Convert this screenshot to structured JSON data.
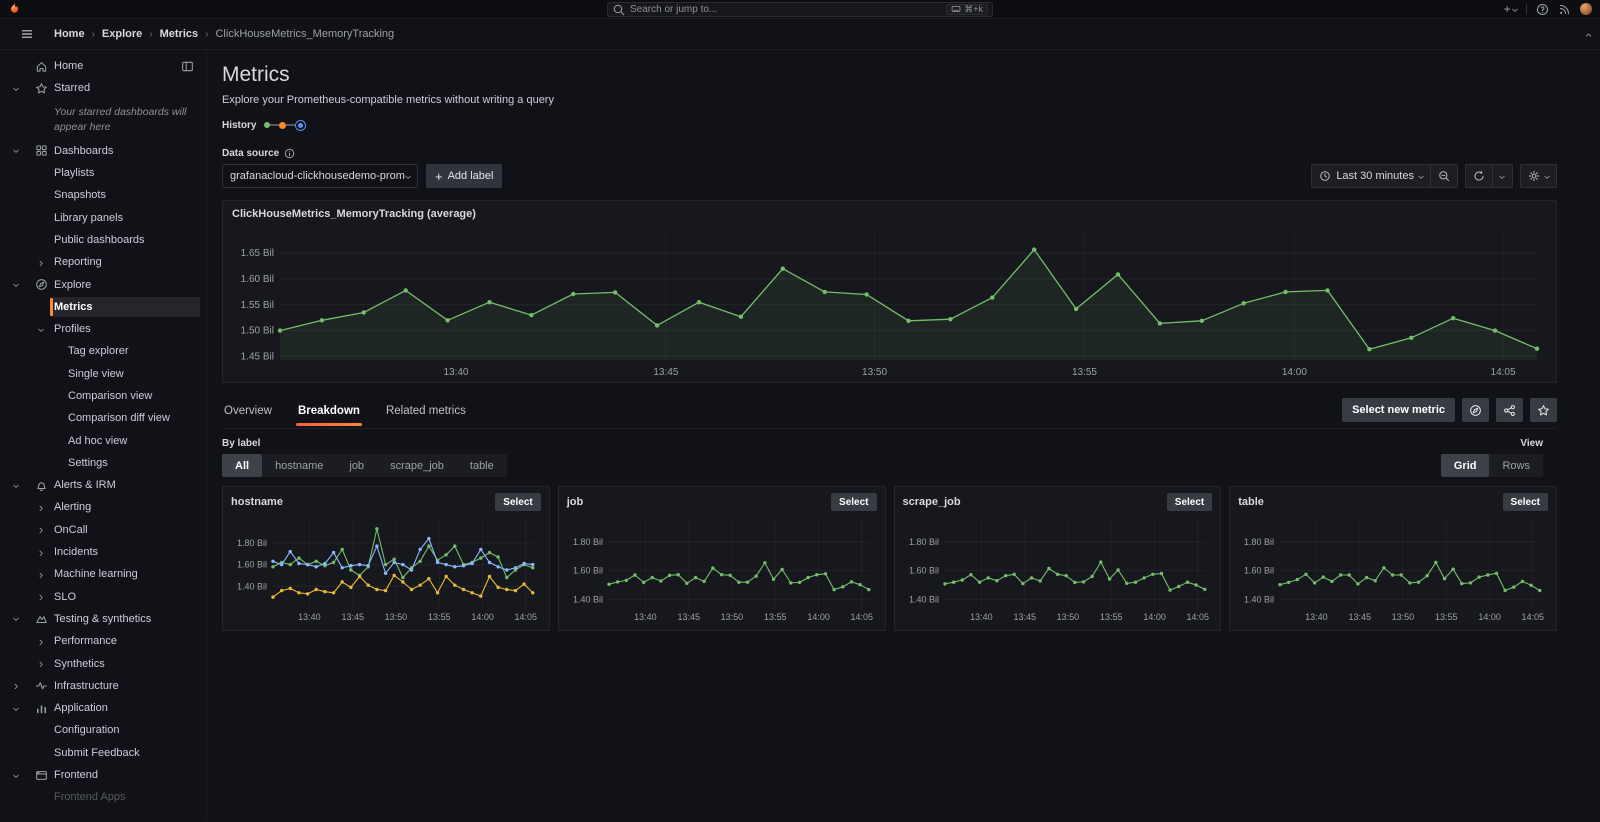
{
  "topbar": {
    "search_placeholder": "Search or jump to...",
    "shortcut": "⌘+k",
    "new_button": "+"
  },
  "breadcrumb": {
    "items": [
      "Home",
      "Explore",
      "Metrics",
      "ClickHouseMetrics_MemoryTracking"
    ]
  },
  "sidebar": {
    "items": [
      {
        "label": "Home",
        "level": 0,
        "icon": "home",
        "right_icon": "dock"
      },
      {
        "label": "Starred",
        "level": 0,
        "icon": "star",
        "chevron": "down"
      },
      {
        "label": "Your starred dashboards will appear here",
        "type": "note"
      },
      {
        "label": "Dashboards",
        "level": 0,
        "icon": "apps",
        "chevron": "down"
      },
      {
        "label": "Playlists",
        "level": 1
      },
      {
        "label": "Snapshots",
        "level": 1
      },
      {
        "label": "Library panels",
        "level": 1
      },
      {
        "label": "Public dashboards",
        "level": 1
      },
      {
        "label": "Reporting",
        "level": 1,
        "chevron": "right"
      },
      {
        "label": "Explore",
        "level": 0,
        "icon": "compass",
        "chevron": "down"
      },
      {
        "label": "Metrics",
        "level": 1,
        "selected": true
      },
      {
        "label": "Profiles",
        "level": 1,
        "chevron": "down"
      },
      {
        "label": "Tag explorer",
        "level": 2
      },
      {
        "label": "Single view",
        "level": 2
      },
      {
        "label": "Comparison view",
        "level": 2
      },
      {
        "label": "Comparison diff view",
        "level": 2
      },
      {
        "label": "Ad hoc view",
        "level": 2
      },
      {
        "label": "Settings",
        "level": 2
      },
      {
        "label": "Alerts & IRM",
        "level": 0,
        "icon": "bell",
        "chevron": "down"
      },
      {
        "label": "Alerting",
        "level": 1,
        "chevron": "right"
      },
      {
        "label": "OnCall",
        "level": 1,
        "chevron": "right"
      },
      {
        "label": "Incidents",
        "level": 1,
        "chevron": "right"
      },
      {
        "label": "Machine learning",
        "level": 1,
        "chevron": "right"
      },
      {
        "label": "SLO",
        "level": 1,
        "chevron": "right"
      },
      {
        "label": "Testing & synthetics",
        "level": 0,
        "icon": "testing",
        "chevron": "down"
      },
      {
        "label": "Performance",
        "level": 1,
        "chevron": "right"
      },
      {
        "label": "Synthetics",
        "level": 1,
        "chevron": "right"
      },
      {
        "label": "Infrastructure",
        "level": 0,
        "icon": "pulse",
        "chevron": "right"
      },
      {
        "label": "Application",
        "level": 0,
        "icon": "barchart",
        "chevron": "down"
      },
      {
        "label": "Configuration",
        "level": 1
      },
      {
        "label": "Submit Feedback",
        "level": 1
      },
      {
        "label": "Frontend",
        "level": 0,
        "icon": "frontend",
        "chevron": "down"
      },
      {
        "label": "Frontend Apps",
        "level": 1,
        "muted": true
      }
    ]
  },
  "page": {
    "title": "Metrics",
    "subtitle": "Explore your Prometheus-compatible metrics without writing a query",
    "history_label": "History",
    "datasource_label": "Data source",
    "datasource_value": "grafanacloud-clickhousedemo-prom",
    "add_label_button": "Add label"
  },
  "toolbar": {
    "time_range": "Last 30 minutes"
  },
  "tabs": {
    "items": [
      {
        "label": "Overview"
      },
      {
        "label": "Breakdown"
      },
      {
        "label": "Related metrics"
      }
    ],
    "active": "Breakdown"
  },
  "actions": {
    "select_new_metric": "Select new metric"
  },
  "by_label": {
    "label": "By label",
    "options": [
      "All",
      "hostname",
      "job",
      "scrape_job",
      "table"
    ],
    "active": "All"
  },
  "view_toggle": {
    "label": "View",
    "options": [
      "Grid",
      "Rows"
    ],
    "active": "Grid"
  },
  "panels": {
    "select_button": "Select"
  },
  "colors": {
    "accent": "#FF8833",
    "green": "#73BF69",
    "blue": "#8AB8FF",
    "yellow": "#EAB839"
  },
  "chart_data": [
    {
      "type": "line",
      "title": "ClickHouseMetrics_MemoryTracking (average)",
      "unit": "Bil",
      "ylim": [
        1.443,
        1.695
      ],
      "yticks": [
        1.45,
        1.5,
        1.55,
        1.6,
        1.65
      ],
      "ytick_labels": [
        "1.45 Bil",
        "1.50 Bil",
        "1.55 Bil",
        "1.60 Bil",
        "1.65 Bil"
      ],
      "xticks": [
        "13:40",
        "13:45",
        "13:50",
        "13:55",
        "14:00",
        "14:05"
      ],
      "xtick_fracs": [
        0.14,
        0.307,
        0.473,
        0.64,
        0.807,
        0.973
      ],
      "grid": true,
      "legend": "none",
      "series": [
        {
          "name": "average",
          "color": "#73BF69",
          "fill": true,
          "values": [
            1.5,
            1.52,
            1.535,
            1.578,
            1.52,
            1.555,
            1.53,
            1.571,
            1.574,
            1.51,
            1.555,
            1.527,
            1.62,
            1.575,
            1.57,
            1.519,
            1.522,
            1.564,
            1.657,
            1.542,
            1.609,
            1.514,
            1.519,
            1.553,
            1.575,
            1.578,
            1.464,
            1.486,
            1.524,
            1.5,
            1.465
          ]
        }
      ]
    },
    {
      "type": "line",
      "title": "hostname",
      "unit": "Bil",
      "ylim": [
        1.2,
        2.02
      ],
      "yticks": [
        1.4,
        1.6,
        1.8
      ],
      "ytick_labels": [
        "1.40 Bil",
        "1.60 Bil",
        "1.80 Bil"
      ],
      "xticks": [
        "13:40",
        "13:45",
        "13:50",
        "13:55",
        "14:00",
        "14:05"
      ],
      "xtick_fracs": [
        0.14,
        0.307,
        0.473,
        0.64,
        0.807,
        0.973
      ],
      "grid": true,
      "legend": "none",
      "series": [
        {
          "name": "series-green",
          "color": "#73BF69",
          "values": [
            1.58,
            1.62,
            1.6,
            1.66,
            1.6,
            1.63,
            1.59,
            1.62,
            1.74,
            1.55,
            1.5,
            1.58,
            1.93,
            1.6,
            1.65,
            1.48,
            1.57,
            1.63,
            1.77,
            1.64,
            1.69,
            1.77,
            1.6,
            1.62,
            1.66,
            1.71,
            1.67,
            1.48,
            1.55,
            1.6,
            1.57
          ]
        },
        {
          "name": "series-blue",
          "color": "#8AB8FF",
          "values": [
            1.63,
            1.6,
            1.72,
            1.61,
            1.6,
            1.58,
            1.61,
            1.71,
            1.57,
            1.59,
            1.6,
            1.59,
            1.77,
            1.52,
            1.62,
            1.6,
            1.55,
            1.74,
            1.84,
            1.62,
            1.6,
            1.58,
            1.59,
            1.61,
            1.74,
            1.62,
            1.58,
            1.55,
            1.57,
            1.61,
            1.6
          ]
        },
        {
          "name": "series-yellow",
          "color": "#EAB839",
          "values": [
            1.3,
            1.36,
            1.38,
            1.34,
            1.33,
            1.37,
            1.35,
            1.34,
            1.44,
            1.39,
            1.49,
            1.41,
            1.37,
            1.36,
            1.5,
            1.44,
            1.37,
            1.41,
            1.47,
            1.34,
            1.49,
            1.41,
            1.37,
            1.34,
            1.31,
            1.49,
            1.39,
            1.37,
            1.36,
            1.42,
            1.34
          ]
        }
      ]
    },
    {
      "type": "line",
      "title": "job",
      "unit": "Bil",
      "ylim": [
        1.34,
        1.96
      ],
      "yticks": [
        1.4,
        1.6,
        1.8
      ],
      "ytick_labels": [
        "1.40 Bil",
        "1.60 Bil",
        "1.80 Bil"
      ],
      "xticks": [
        "13:40",
        "13:45",
        "13:50",
        "13:55",
        "14:00",
        "14:05"
      ],
      "xtick_fracs": [
        0.14,
        0.307,
        0.473,
        0.64,
        0.807,
        0.973
      ],
      "grid": true,
      "legend": "none",
      "series": [
        {
          "name": "series-green",
          "color": "#73BF69",
          "values": [
            1.505,
            1.522,
            1.532,
            1.57,
            1.518,
            1.552,
            1.528,
            1.568,
            1.572,
            1.512,
            1.552,
            1.525,
            1.618,
            1.572,
            1.568,
            1.52,
            1.52,
            1.562,
            1.655,
            1.54,
            1.608,
            1.515,
            1.518,
            1.552,
            1.572,
            1.578,
            1.468,
            1.488,
            1.522,
            1.502,
            1.468
          ]
        }
      ]
    },
    {
      "type": "line",
      "title": "scrape_job",
      "unit": "Bil",
      "ylim": [
        1.34,
        1.96
      ],
      "yticks": [
        1.4,
        1.6,
        1.8
      ],
      "ytick_labels": [
        "1.40 Bil",
        "1.60 Bil",
        "1.80 Bil"
      ],
      "xticks": [
        "13:40",
        "13:45",
        "13:50",
        "13:55",
        "14:00",
        "14:05"
      ],
      "xtick_fracs": [
        0.14,
        0.307,
        0.473,
        0.64,
        0.807,
        0.973
      ],
      "grid": true,
      "legend": "none",
      "series": [
        {
          "name": "series-green",
          "color": "#73BF69",
          "values": [
            1.508,
            1.52,
            1.535,
            1.572,
            1.52,
            1.55,
            1.53,
            1.565,
            1.575,
            1.51,
            1.55,
            1.528,
            1.615,
            1.575,
            1.565,
            1.518,
            1.522,
            1.56,
            1.66,
            1.542,
            1.605,
            1.512,
            1.52,
            1.55,
            1.575,
            1.58,
            1.465,
            1.49,
            1.52,
            1.5,
            1.47
          ]
        }
      ]
    },
    {
      "type": "line",
      "title": "table",
      "unit": "Bil",
      "ylim": [
        1.34,
        1.96
      ],
      "yticks": [
        1.4,
        1.6,
        1.8
      ],
      "ytick_labels": [
        "1.40 Bil",
        "1.60 Bil",
        "1.80 Bil"
      ],
      "xticks": [
        "13:40",
        "13:45",
        "13:50",
        "13:55",
        "14:00",
        "14:05"
      ],
      "xtick_fracs": [
        0.14,
        0.307,
        0.473,
        0.64,
        0.807,
        0.973
      ],
      "grid": true,
      "legend": "none",
      "series": [
        {
          "name": "series-green",
          "color": "#73BF69",
          "values": [
            1.502,
            1.518,
            1.538,
            1.575,
            1.515,
            1.555,
            1.525,
            1.57,
            1.57,
            1.508,
            1.552,
            1.53,
            1.62,
            1.57,
            1.57,
            1.515,
            1.52,
            1.565,
            1.658,
            1.545,
            1.61,
            1.51,
            1.515,
            1.555,
            1.57,
            1.582,
            1.462,
            1.485,
            1.525,
            1.498,
            1.462
          ]
        }
      ]
    }
  ]
}
